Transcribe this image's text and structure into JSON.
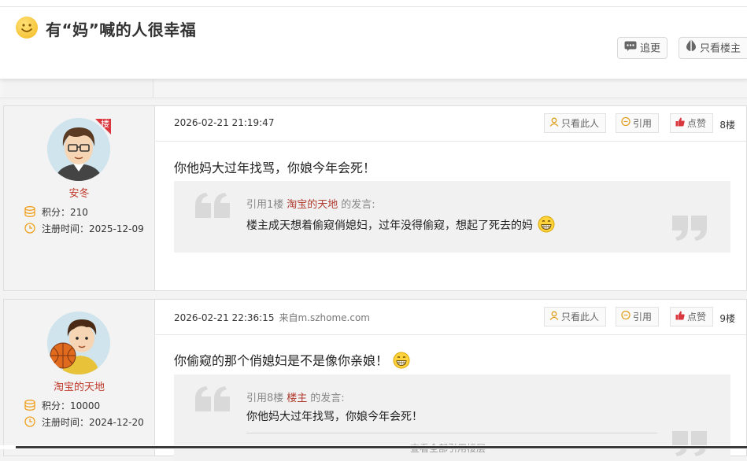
{
  "header": {
    "title": "有“妈”喊的人很幸福",
    "buttons": {
      "reply": "追更",
      "op_only": "只看楼主"
    }
  },
  "posts": [
    {
      "username": "安冬",
      "is_op_badge": "楼",
      "points_label": "积分：",
      "points": "210",
      "reg_label": "注册时间：",
      "reg_date": "2025-12-09",
      "time": "2026-02-21 21:19:47",
      "source": "",
      "btn_only_this": "只看此人",
      "btn_quote": "引用",
      "btn_like": "点赞",
      "floor": "8楼",
      "content": "你他妈大过年找骂，你娘今年会死！",
      "quote": {
        "prefix": "引用1楼",
        "name": "淘宝的天地",
        "suffix": "的发言:",
        "text": "楼主成天想着偷窥俏媳妇，过年没得偷窥，想起了死去的妈"
      }
    },
    {
      "username": "淘宝的天地",
      "points_label": "积分：",
      "points": "10000",
      "reg_label": "注册时间：",
      "reg_date": "2024-12-20",
      "time": "2026-02-21 22:36:15",
      "source": "来自m.szhome.com",
      "btn_only_this": "只看此人",
      "btn_quote": "引用",
      "btn_like": "点赞",
      "floor": "9楼",
      "content": "你偷窥的那个俏媳妇是不是像你亲娘！",
      "quote": {
        "prefix": "引用8楼",
        "name": "楼主",
        "suffix": "的发言:",
        "text": "你他妈大过年找骂，你娘今年会死！",
        "more": "查看全部引用楼层"
      }
    }
  ],
  "colors": {
    "accent_red": "#c0392b",
    "like_red": "#d9363e",
    "coin_orange": "#f0a020"
  }
}
